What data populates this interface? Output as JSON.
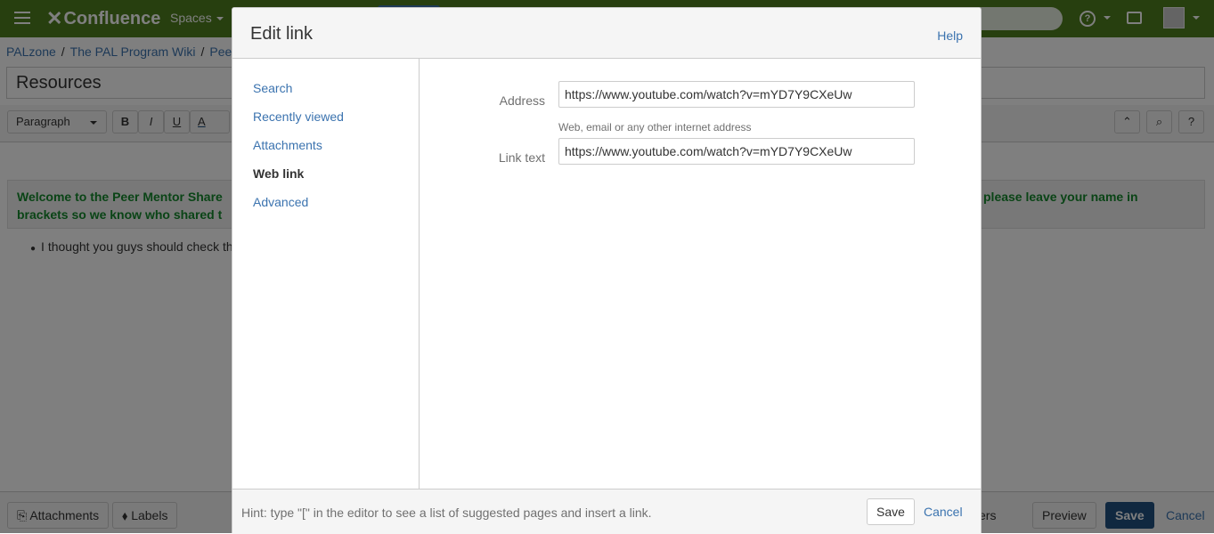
{
  "app": {
    "logo_text": "Confluence",
    "nav_spaces": "Spaces"
  },
  "breadcrumb": [
    "PALzone",
    "The PAL Program Wiki",
    "Pee"
  ],
  "page": {
    "title": "Resources",
    "info_panel_line1": "Welcome to the Peer Mentor Share",
    "info_panel_line1_right": "please leave your name in",
    "info_panel_line2": "brackets so we know who shared t",
    "bullet_text": "I thought you guys should check th"
  },
  "toolbar": {
    "paragraph_select": "Paragraph",
    "bold": "B",
    "italic": "I",
    "underline": "U",
    "text_color": "A"
  },
  "bottombar": {
    "attachments": "Attachments",
    "labels": "Labels",
    "restrictions_fragment": "ers",
    "preview": "Preview",
    "save": "Save",
    "cancel": "Cancel"
  },
  "dialog": {
    "title": "Edit link",
    "help": "Help",
    "menu": [
      {
        "label": "Search",
        "active": false
      },
      {
        "label": "Recently viewed",
        "active": false
      },
      {
        "label": "Attachments",
        "active": false
      },
      {
        "label": "Web link",
        "active": true
      },
      {
        "label": "Advanced",
        "active": false
      }
    ],
    "address_label": "Address",
    "address_value": "https://www.youtube.com/watch?v=mYD7Y9CXeUw",
    "address_desc": "Web, email or any other internet address",
    "link_text_label": "Link text",
    "link_text_value": "https://www.youtube.com/watch?v=mYD7Y9CXeUw",
    "hint": "Hint: type \"[\" in the editor to see a list of suggested pages and insert a link.",
    "save": "Save",
    "cancel": "Cancel"
  },
  "colors": {
    "header_bg": "#4e7f1f",
    "link": "#3b73af",
    "primary_button": "#205081",
    "info_text": "#14892c"
  }
}
